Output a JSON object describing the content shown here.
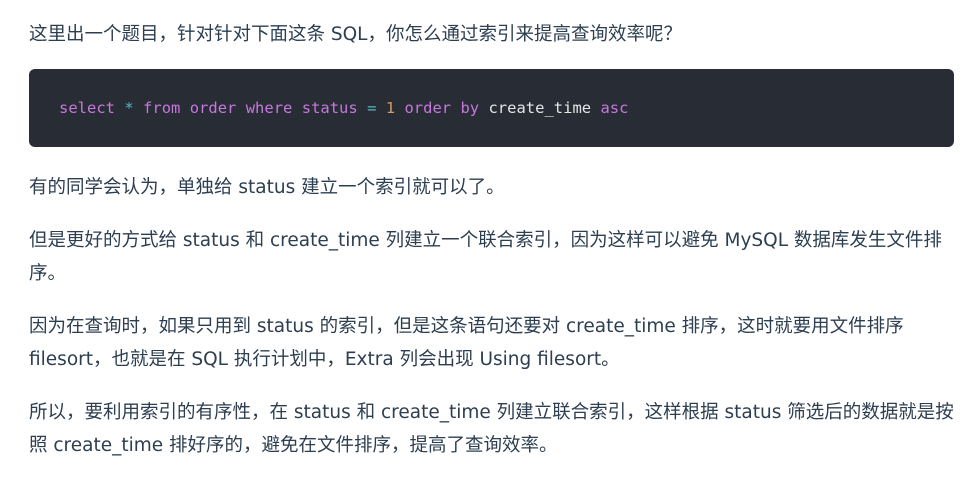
{
  "article": {
    "intro": "这里出一个题目，针对针对下面这条 SQL，你怎么通过索引来提高查询效率呢？",
    "code": {
      "select": "select",
      "star": "*",
      "from": "from",
      "table": "order",
      "where": "where",
      "field": "status",
      "eq": "=",
      "value": "1",
      "order_by": "order by",
      "sort_field": "create_time",
      "dir": "asc"
    },
    "paragraphs": [
      "有的同学会认为，单独给 status 建立一个索引就可以了。",
      "但是更好的方式给 status 和 create_time 列建立一个联合索引，因为这样可以避免 MySQL 数据库发生文件排序。",
      "因为在查询时，如果只用到 status 的索引，但是这条语句还要对 create_time 排序，这时就要用文件排序 filesort，也就是在 SQL 执行计划中，Extra 列会出现 Using filesort。",
      "所以，要利用索引的有序性，在 status 和 create_time 列建立联合索引，这样根据 status 筛选后的数据就是按照 create_time 排好序的，避免在文件排序，提高了查询效率。"
    ]
  }
}
